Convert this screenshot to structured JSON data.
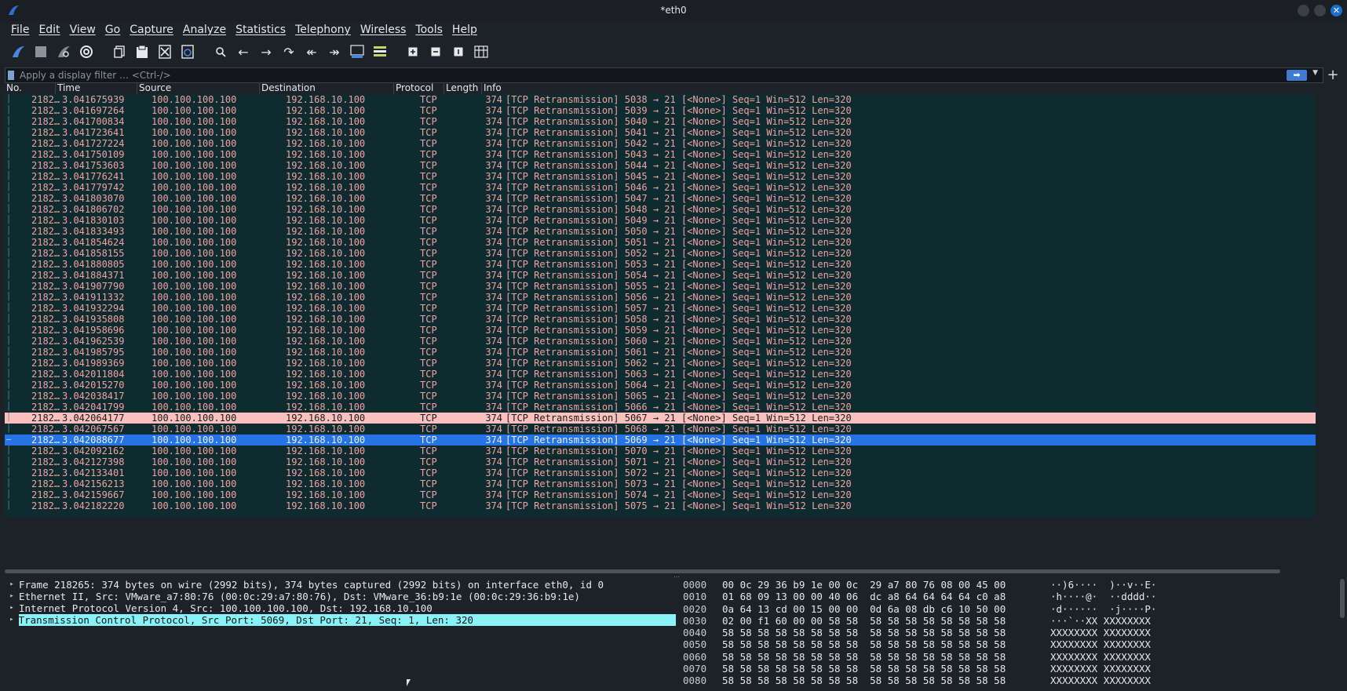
{
  "window": {
    "title": "*eth0"
  },
  "menu": [
    "File",
    "Edit",
    "View",
    "Go",
    "Capture",
    "Analyze",
    "Statistics",
    "Telephony",
    "Wireless",
    "Tools",
    "Help"
  ],
  "filter": {
    "placeholder": "Apply a display filter … <Ctrl-/>",
    "plus": "+"
  },
  "columns": {
    "no": "No.",
    "time": "Time",
    "source": "Source",
    "destination": "Destination",
    "protocol": "Protocol",
    "length": "Length",
    "info": "Info"
  },
  "packets": [
    {
      "no": "2182…",
      "time": "3.041675939",
      "src": "100.100.100.100",
      "dst": "192.168.10.100",
      "proto": "TCP",
      "len": "374",
      "info": "[TCP Retransmission] 5038 → 21 [<None>] Seq=1 Win=512 Len=320"
    },
    {
      "no": "2182…",
      "time": "3.041697264",
      "src": "100.100.100.100",
      "dst": "192.168.10.100",
      "proto": "TCP",
      "len": "374",
      "info": "[TCP Retransmission] 5039 → 21 [<None>] Seq=1 Win=512 Len=320"
    },
    {
      "no": "2182…",
      "time": "3.041700834",
      "src": "100.100.100.100",
      "dst": "192.168.10.100",
      "proto": "TCP",
      "len": "374",
      "info": "[TCP Retransmission] 5040 → 21 [<None>] Seq=1 Win=512 Len=320"
    },
    {
      "no": "2182…",
      "time": "3.041723641",
      "src": "100.100.100.100",
      "dst": "192.168.10.100",
      "proto": "TCP",
      "len": "374",
      "info": "[TCP Retransmission] 5041 → 21 [<None>] Seq=1 Win=512 Len=320"
    },
    {
      "no": "2182…",
      "time": "3.041727224",
      "src": "100.100.100.100",
      "dst": "192.168.10.100",
      "proto": "TCP",
      "len": "374",
      "info": "[TCP Retransmission] 5042 → 21 [<None>] Seq=1 Win=512 Len=320"
    },
    {
      "no": "2182…",
      "time": "3.041750109",
      "src": "100.100.100.100",
      "dst": "192.168.10.100",
      "proto": "TCP",
      "len": "374",
      "info": "[TCP Retransmission] 5043 → 21 [<None>] Seq=1 Win=512 Len=320"
    },
    {
      "no": "2182…",
      "time": "3.041753603",
      "src": "100.100.100.100",
      "dst": "192.168.10.100",
      "proto": "TCP",
      "len": "374",
      "info": "[TCP Retransmission] 5044 → 21 [<None>] Seq=1 Win=512 Len=320"
    },
    {
      "no": "2182…",
      "time": "3.041776241",
      "src": "100.100.100.100",
      "dst": "192.168.10.100",
      "proto": "TCP",
      "len": "374",
      "info": "[TCP Retransmission] 5045 → 21 [<None>] Seq=1 Win=512 Len=320"
    },
    {
      "no": "2182…",
      "time": "3.041779742",
      "src": "100.100.100.100",
      "dst": "192.168.10.100",
      "proto": "TCP",
      "len": "374",
      "info": "[TCP Retransmission] 5046 → 21 [<None>] Seq=1 Win=512 Len=320"
    },
    {
      "no": "2182…",
      "time": "3.041803070",
      "src": "100.100.100.100",
      "dst": "192.168.10.100",
      "proto": "TCP",
      "len": "374",
      "info": "[TCP Retransmission] 5047 → 21 [<None>] Seq=1 Win=512 Len=320"
    },
    {
      "no": "2182…",
      "time": "3.041806702",
      "src": "100.100.100.100",
      "dst": "192.168.10.100",
      "proto": "TCP",
      "len": "374",
      "info": "[TCP Retransmission] 5048 → 21 [<None>] Seq=1 Win=512 Len=320"
    },
    {
      "no": "2182…",
      "time": "3.041830103",
      "src": "100.100.100.100",
      "dst": "192.168.10.100",
      "proto": "TCP",
      "len": "374",
      "info": "[TCP Retransmission] 5049 → 21 [<None>] Seq=1 Win=512 Len=320"
    },
    {
      "no": "2182…",
      "time": "3.041833493",
      "src": "100.100.100.100",
      "dst": "192.168.10.100",
      "proto": "TCP",
      "len": "374",
      "info": "[TCP Retransmission] 5050 → 21 [<None>] Seq=1 Win=512 Len=320"
    },
    {
      "no": "2182…",
      "time": "3.041854624",
      "src": "100.100.100.100",
      "dst": "192.168.10.100",
      "proto": "TCP",
      "len": "374",
      "info": "[TCP Retransmission] 5051 → 21 [<None>] Seq=1 Win=512 Len=320"
    },
    {
      "no": "2182…",
      "time": "3.041858155",
      "src": "100.100.100.100",
      "dst": "192.168.10.100",
      "proto": "TCP",
      "len": "374",
      "info": "[TCP Retransmission] 5052 → 21 [<None>] Seq=1 Win=512 Len=320"
    },
    {
      "no": "2182…",
      "time": "3.041880805",
      "src": "100.100.100.100",
      "dst": "192.168.10.100",
      "proto": "TCP",
      "len": "374",
      "info": "[TCP Retransmission] 5053 → 21 [<None>] Seq=1 Win=512 Len=320"
    },
    {
      "no": "2182…",
      "time": "3.041884371",
      "src": "100.100.100.100",
      "dst": "192.168.10.100",
      "proto": "TCP",
      "len": "374",
      "info": "[TCP Retransmission] 5054 → 21 [<None>] Seq=1 Win=512 Len=320"
    },
    {
      "no": "2182…",
      "time": "3.041907790",
      "src": "100.100.100.100",
      "dst": "192.168.10.100",
      "proto": "TCP",
      "len": "374",
      "info": "[TCP Retransmission] 5055 → 21 [<None>] Seq=1 Win=512 Len=320"
    },
    {
      "no": "2182…",
      "time": "3.041911332",
      "src": "100.100.100.100",
      "dst": "192.168.10.100",
      "proto": "TCP",
      "len": "374",
      "info": "[TCP Retransmission] 5056 → 21 [<None>] Seq=1 Win=512 Len=320"
    },
    {
      "no": "2182…",
      "time": "3.041932294",
      "src": "100.100.100.100",
      "dst": "192.168.10.100",
      "proto": "TCP",
      "len": "374",
      "info": "[TCP Retransmission] 5057 → 21 [<None>] Seq=1 Win=512 Len=320"
    },
    {
      "no": "2182…",
      "time": "3.041935808",
      "src": "100.100.100.100",
      "dst": "192.168.10.100",
      "proto": "TCP",
      "len": "374",
      "info": "[TCP Retransmission] 5058 → 21 [<None>] Seq=1 Win=512 Len=320"
    },
    {
      "no": "2182…",
      "time": "3.041958696",
      "src": "100.100.100.100",
      "dst": "192.168.10.100",
      "proto": "TCP",
      "len": "374",
      "info": "[TCP Retransmission] 5059 → 21 [<None>] Seq=1 Win=512 Len=320"
    },
    {
      "no": "2182…",
      "time": "3.041962539",
      "src": "100.100.100.100",
      "dst": "192.168.10.100",
      "proto": "TCP",
      "len": "374",
      "info": "[TCP Retransmission] 5060 → 21 [<None>] Seq=1 Win=512 Len=320"
    },
    {
      "no": "2182…",
      "time": "3.041985795",
      "src": "100.100.100.100",
      "dst": "192.168.10.100",
      "proto": "TCP",
      "len": "374",
      "info": "[TCP Retransmission] 5061 → 21 [<None>] Seq=1 Win=512 Len=320"
    },
    {
      "no": "2182…",
      "time": "3.041989369",
      "src": "100.100.100.100",
      "dst": "192.168.10.100",
      "proto": "TCP",
      "len": "374",
      "info": "[TCP Retransmission] 5062 → 21 [<None>] Seq=1 Win=512 Len=320"
    },
    {
      "no": "2182…",
      "time": "3.042011804",
      "src": "100.100.100.100",
      "dst": "192.168.10.100",
      "proto": "TCP",
      "len": "374",
      "info": "[TCP Retransmission] 5063 → 21 [<None>] Seq=1 Win=512 Len=320"
    },
    {
      "no": "2182…",
      "time": "3.042015270",
      "src": "100.100.100.100",
      "dst": "192.168.10.100",
      "proto": "TCP",
      "len": "374",
      "info": "[TCP Retransmission] 5064 → 21 [<None>] Seq=1 Win=512 Len=320"
    },
    {
      "no": "2182…",
      "time": "3.042038417",
      "src": "100.100.100.100",
      "dst": "192.168.10.100",
      "proto": "TCP",
      "len": "374",
      "info": "[TCP Retransmission] 5065 → 21 [<None>] Seq=1 Win=512 Len=320"
    },
    {
      "no": "2182…",
      "time": "3.042041799",
      "src": "100.100.100.100",
      "dst": "192.168.10.100",
      "proto": "TCP",
      "len": "374",
      "info": "[TCP Retransmission] 5066 → 21 [<None>] Seq=1 Win=512 Len=320"
    },
    {
      "no": "2182…",
      "time": "3.042064177",
      "src": "100.100.100.100",
      "dst": "192.168.10.100",
      "proto": "TCP",
      "len": "374",
      "info": "[TCP Retransmission] 5067 → 21 [<None>] Seq=1 Win=512 Len=320",
      "state": "highlight"
    },
    {
      "no": "2182…",
      "time": "3.042067567",
      "src": "100.100.100.100",
      "dst": "192.168.10.100",
      "proto": "TCP",
      "len": "374",
      "info": "[TCP Retransmission] 5068 → 21 [<None>] Seq=1 Win=512 Len=320"
    },
    {
      "no": "2182…",
      "time": "3.042088677",
      "src": "100.100.100.100",
      "dst": "192.168.10.100",
      "proto": "TCP",
      "len": "374",
      "info": "[TCP Retransmission] 5069 → 21 [<None>] Seq=1 Win=512 Len=320",
      "state": "selected"
    },
    {
      "no": "2182…",
      "time": "3.042092162",
      "src": "100.100.100.100",
      "dst": "192.168.10.100",
      "proto": "TCP",
      "len": "374",
      "info": "[TCP Retransmission] 5070 → 21 [<None>] Seq=1 Win=512 Len=320"
    },
    {
      "no": "2182…",
      "time": "3.042127398",
      "src": "100.100.100.100",
      "dst": "192.168.10.100",
      "proto": "TCP",
      "len": "374",
      "info": "[TCP Retransmission] 5071 → 21 [<None>] Seq=1 Win=512 Len=320"
    },
    {
      "no": "2182…",
      "time": "3.042133401",
      "src": "100.100.100.100",
      "dst": "192.168.10.100",
      "proto": "TCP",
      "len": "374",
      "info": "[TCP Retransmission] 5072 → 21 [<None>] Seq=1 Win=512 Len=320"
    },
    {
      "no": "2182…",
      "time": "3.042156213",
      "src": "100.100.100.100",
      "dst": "192.168.10.100",
      "proto": "TCP",
      "len": "374",
      "info": "[TCP Retransmission] 5073 → 21 [<None>] Seq=1 Win=512 Len=320"
    },
    {
      "no": "2182…",
      "time": "3.042159667",
      "src": "100.100.100.100",
      "dst": "192.168.10.100",
      "proto": "TCP",
      "len": "374",
      "info": "[TCP Retransmission] 5074 → 21 [<None>] Seq=1 Win=512 Len=320"
    },
    {
      "no": "2182…",
      "time": "3.042182220",
      "src": "100.100.100.100",
      "dst": "192.168.10.100",
      "proto": "TCP",
      "len": "374",
      "info": "[TCP Retransmission] 5075 → 21 [<None>] Seq=1 Win=512 Len=320"
    }
  ],
  "details": [
    {
      "text": "Frame 218265: 374 bytes on wire (2992 bits), 374 bytes captured (2992 bits) on interface eth0, id 0"
    },
    {
      "text": "Ethernet II, Src: VMware_a7:80:76 (00:0c:29:a7:80:76), Dst: VMware_36:b9:1e (00:0c:29:36:b9:1e)"
    },
    {
      "text": "Internet Protocol Version 4, Src: 100.100.100.100, Dst: 192.168.10.100"
    },
    {
      "text": "Transmission Control Protocol, Src Port: 5069, Dst Port: 21, Seq: 1, Len: 320",
      "selected": true
    }
  ],
  "bytes": [
    {
      "offset": "0000",
      "hex": "00 0c 29 36 b9 1e 00 0c  29 a7 80 76 08 00 45 00",
      "ascii": "··)6····  )··v··E·"
    },
    {
      "offset": "0010",
      "hex": "01 68 09 13 00 00 40 06  dc a8 64 64 64 64 c0 a8",
      "ascii": "·h····@·  ··dddd··"
    },
    {
      "offset": "0020",
      "hex": "0a 64 13 cd 00 15 00 00  0d 6a 08 db c6 10 50 00",
      "ascii": "·d······  ·j····P·"
    },
    {
      "offset": "0030",
      "hex": "02 00 f1 60 00 00 58 58  58 58 58 58 58 58 58 58",
      "ascii": "···`··XX XXXXXXXX"
    },
    {
      "offset": "0040",
      "hex": "58 58 58 58 58 58 58 58  58 58 58 58 58 58 58 58",
      "ascii": "XXXXXXXX XXXXXXXX"
    },
    {
      "offset": "0050",
      "hex": "58 58 58 58 58 58 58 58  58 58 58 58 58 58 58 58",
      "ascii": "XXXXXXXX XXXXXXXX"
    },
    {
      "offset": "0060",
      "hex": "58 58 58 58 58 58 58 58  58 58 58 58 58 58 58 58",
      "ascii": "XXXXXXXX XXXXXXXX"
    },
    {
      "offset": "0070",
      "hex": "58 58 58 58 58 58 58 58  58 58 58 58 58 58 58 58",
      "ascii": "XXXXXXXX XXXXXXXX"
    },
    {
      "offset": "0080",
      "hex": "58 58 58 58 58 58 58 58  58 58 58 58 58 58 58 58",
      "ascii": "XXXXXXXX XXXXXXXX"
    }
  ],
  "colors": {
    "bad_tcp_fg": "#f2a2a0",
    "bad_tcp_bg": "#0e2b2f",
    "highlight_bg": "#f9c0bd",
    "selected_bg": "#2673e6",
    "detail_selected_bg": "#88f2f7"
  }
}
